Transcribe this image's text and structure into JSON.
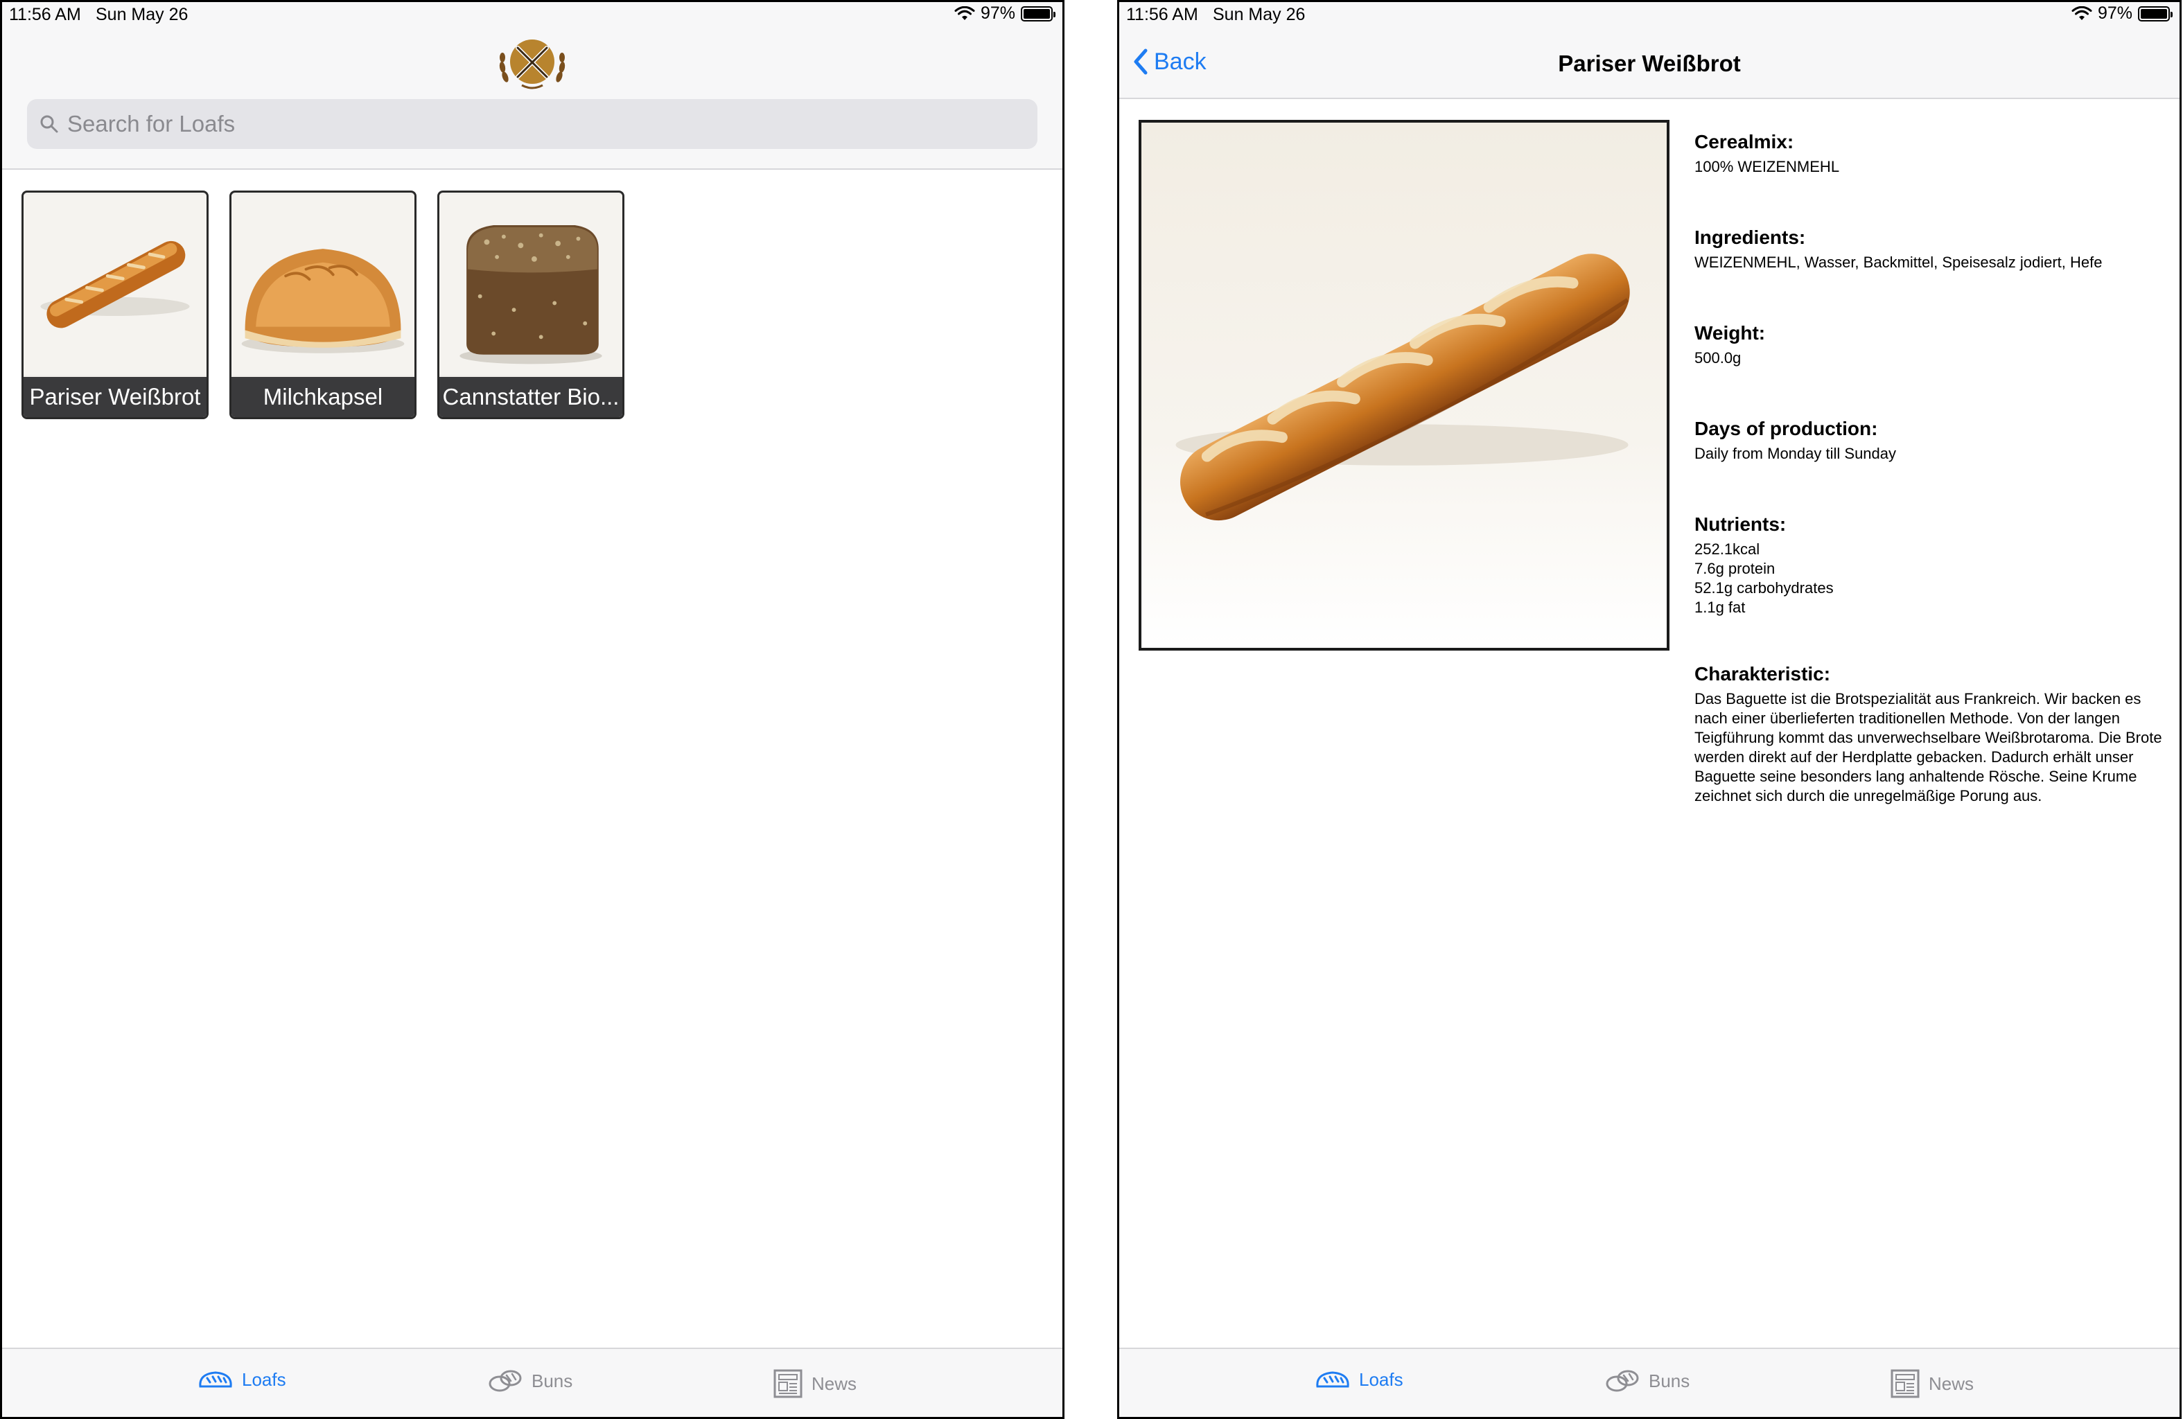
{
  "left": {
    "status": {
      "time": "11:56 AM",
      "date": "Sun May 26",
      "battery": "97%"
    },
    "search": {
      "placeholder": "Search for Loafs"
    },
    "loafs": [
      {
        "name": "Pariser Weißbrot"
      },
      {
        "name": "Milchkapsel"
      },
      {
        "name": "Cannstatter Bio..."
      }
    ],
    "tabs": [
      {
        "label": "Loafs",
        "icon": "bread-icon",
        "active": true
      },
      {
        "label": "Buns",
        "icon": "buns-icon",
        "active": false
      },
      {
        "label": "News",
        "icon": "newspaper-icon",
        "active": false
      }
    ]
  },
  "right": {
    "status": {
      "time": "11:56 AM",
      "date": "Sun May 26",
      "battery": "97%"
    },
    "nav": {
      "back_label": "Back",
      "title": "Pariser Weißbrot"
    },
    "details": {
      "cerealmix": {
        "label": "Cerealmix:",
        "value": "100% WEIZENMEHL"
      },
      "ingredients": {
        "label": "Ingredients:",
        "value": "WEIZENMEHL, Wasser, Backmittel, Speisesalz jodiert, Hefe"
      },
      "weight": {
        "label": "Weight:",
        "value": "500.0g"
      },
      "days": {
        "label": "Days of production:",
        "value": "Daily from Monday till Sunday"
      },
      "nutrients": {
        "label": "Nutrients:",
        "values": [
          "252.1kcal",
          "7.6g protein",
          "52.1g carbohydrates",
          "1.1g fat"
        ]
      },
      "characteristic": {
        "label": "Charakteristic:",
        "value": "Das Baguette ist die Brotspezialität aus Frankreich. Wir backen es nach einer überlieferten traditionellen Methode. Von der langen Teigführung kommt das unverwechselbare Weißbrotaroma. Die Brote werden direkt auf der Herdplatte gebacken. Dadurch erhält unser Baguette seine besonders lang anhaltende Rösche. Seine Krume zeichnet sich durch die unregelmäßige Porung aus."
      }
    },
    "tabs": [
      {
        "label": "Loafs",
        "icon": "bread-icon",
        "active": true
      },
      {
        "label": "Buns",
        "icon": "buns-icon",
        "active": false
      },
      {
        "label": "News",
        "icon": "newspaper-icon",
        "active": false
      }
    ]
  },
  "colors": {
    "accent": "#1e7cf2",
    "inactive": "#8e8e93",
    "caption_bg": "#3a3a3c",
    "logo_gold": "#b8842e"
  }
}
